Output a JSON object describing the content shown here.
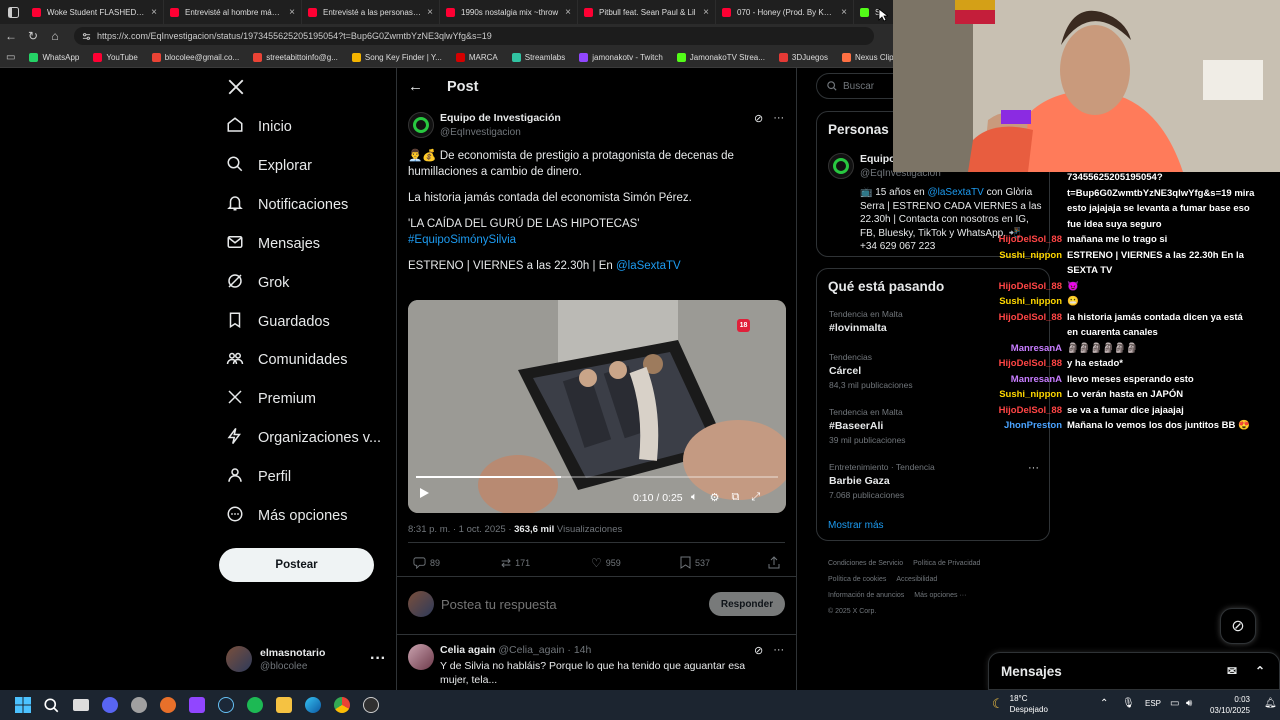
{
  "browser": {
    "tabs": [
      {
        "label": "Woke Student FLASHED Ch",
        "color": "#ff0033"
      },
      {
        "label": "Entrevisté al hombre más R",
        "color": "#ff0033"
      },
      {
        "label": "Entrevisté a las personas ne",
        "color": "#ff0033"
      },
      {
        "label": "1990s nostalgia mix ~throw",
        "color": "#ff0033"
      },
      {
        "label": "Pitbull feat. Sean Paul & Lil",
        "color": "#ff0033"
      },
      {
        "label": "070 - Honey (Prod. By Korn",
        "color": "#ff0033"
      },
      {
        "label": "Stre",
        "color": "#53fc18"
      }
    ],
    "url": "https://x.com/EqInvestigacion/status/1973455625205195054?t=Bup6G0ZwmtbYzNE3qlwYfg&s=19",
    "bookmarks": [
      {
        "label": "WhatsApp",
        "color": "#25d366"
      },
      {
        "label": "YouTube",
        "color": "#ff0033"
      },
      {
        "label": "blocolee@gmail.co...",
        "color": "#ea4335"
      },
      {
        "label": "streetabittoinfo@g...",
        "color": "#ea4335"
      },
      {
        "label": "Song Key Finder | Y...",
        "color": "#f4b400"
      },
      {
        "label": "MARCA",
        "color": "#d50000"
      },
      {
        "label": "Streamlabs",
        "color": "#31c3a2"
      },
      {
        "label": "jamonakotv - Twitch",
        "color": "#9146ff"
      },
      {
        "label": "JamonakoTV Strea...",
        "color": "#53fc18"
      },
      {
        "label": "3DJuegos",
        "color": "#e53935"
      },
      {
        "label": "Nexus Clips",
        "color": "#ff7043"
      }
    ]
  },
  "nav": {
    "items": [
      "Inicio",
      "Explorar",
      "Notificaciones",
      "Mensajes",
      "Grok",
      "Guardados",
      "Comunidades",
      "Premium",
      "Organizaciones v...",
      "Perfil",
      "Más opciones"
    ],
    "post_button": "Postear",
    "account": {
      "name": "elmasnotario",
      "handle": "@blocolee"
    }
  },
  "post": {
    "header": "Post",
    "author_name": "Equipo de Investigación",
    "author_handle": "@EqInvestigacion",
    "text_line1": "De economista de prestigio a protagonista de decenas de humillaciones a cambio de dinero.",
    "text_line2": "La historia jamás contada del economista Simón Pérez.",
    "text_line3": "'LA CAÍDA DEL GURÚ DE LAS HIPOTECAS'",
    "hashtag": "#EquipoSimónySilvia",
    "text_line4": "ESTRENO | VIERNES a las 22.30h | En",
    "mention": "@laSextaTV",
    "video": {
      "rating": "18",
      "time": "0:10 / 0:25",
      "progress": 0.4
    },
    "meta_time": "8:31 p. m. · 1 oct. 2025 · ",
    "meta_views": "363,6 mil",
    "meta_views_label": " Visualizaciones",
    "stats": {
      "replies": "89",
      "reposts": "171",
      "likes": "959",
      "bookmarks": "537"
    },
    "reply_placeholder": "Postea tu respuesta",
    "reply_button": "Responder",
    "reply": {
      "name": "Celia again",
      "handle": "@Celia_again · 14h",
      "text": "Y de Silvia no habláis? Porque lo que ha tenido que aguantar esa mujer, tela..."
    }
  },
  "right": {
    "search_placeholder": "Buscar",
    "people_title": "Personas",
    "person_name": "Equipo",
    "person_handle": "@EqInvestigacion",
    "person_bio_prefix": "15 años en ",
    "person_bio_mention": "@laSextaTV",
    "person_bio_rest": " con Glòria Serra | ESTRENO CADA VIERNES a las 22.30h | Contacta con nosotros en IG, FB, Bluesky, TikTok y WhatsApp.",
    "person_phone": "+34 629 067 223",
    "trends_title": "Qué está pasando",
    "trends": [
      {
        "cat": "Tendencia en Malta",
        "name": "#lovinmalta",
        "count": ""
      },
      {
        "cat": "Tendencias",
        "name": "Cárcel",
        "count": "84,3 mil publicaciones"
      },
      {
        "cat": "Tendencia en Malta",
        "name": "#BaseerAli",
        "count": "39 mil publicaciones"
      },
      {
        "cat": "Entretenimiento · Tendencia",
        "name": "Barbie Gaza",
        "count": "7.068 publicaciones"
      }
    ],
    "show_more": "Mostrar más",
    "footer": [
      "Condiciones de Servicio",
      "Política de Privacidad",
      "Política de cookies",
      "Accesibilidad",
      "Información de anuncios",
      "Más opciones ···",
      "© 2025 X Corp."
    ]
  },
  "chat": [
    {
      "user": "",
      "msg": "73455625205195054?",
      "color": "#ffffff"
    },
    {
      "user": "",
      "msg": "t=Bup6G0ZwmtbYzNE3qlwYfg&s=19 mira",
      "color": "#ffffff"
    },
    {
      "user": "",
      "msg": "esto jajajaja se levanta a fumar base eso",
      "color": "#ffffff"
    },
    {
      "user": "",
      "msg": "fue idea suya seguro",
      "color": "#ffffff"
    },
    {
      "user": "HijoDelSol_88",
      "msg": "mañana me lo trago si",
      "color": "#ff4545"
    },
    {
      "user": "Sushi_nippon",
      "msg": "ESTRENO | VIERNES a las 22.30h En la",
      "color": "#ffd700"
    },
    {
      "user": "",
      "msg": "SEXTA TV",
      "color": "#ffffff"
    },
    {
      "user": "HijoDelSol_88",
      "msg": "😈",
      "color": "#ff4545"
    },
    {
      "user": "Sushi_nippon",
      "msg": "😬",
      "color": "#ffd700"
    },
    {
      "user": "HijoDelSol_88",
      "msg": "la historia jamás contada dicen ya está",
      "color": "#ff4545"
    },
    {
      "user": "",
      "msg": "en cuarenta canales",
      "color": "#ffffff"
    },
    {
      "user": "ManresanA",
      "msg": "🗿🗿🗿🗿🗿🗿",
      "color": "#c77dff"
    },
    {
      "user": "HijoDelSol_88",
      "msg": "y ha estado*",
      "color": "#ff4545"
    },
    {
      "user": "ManresanA",
      "msg": "llevo meses esperando esto",
      "color": "#c77dff"
    },
    {
      "user": "Sushi_nippon",
      "msg": "Lo verán hasta en JAPÓN",
      "color": "#ffd700"
    },
    {
      "user": "HijoDelSol_88",
      "msg": "se va a fumar dice jajaajaj",
      "color": "#ff4545"
    },
    {
      "user": "JhonPreston",
      "msg": "Mañana lo vemos los dos juntitos BB 😍",
      "color": "#4aa3ff"
    }
  ],
  "messages_drawer": "Mensajes",
  "taskbar": {
    "weather_temp": "18°C",
    "weather_desc": "Despejado",
    "lang": "ESP",
    "time": "0:03",
    "date": "03/10/2025"
  }
}
